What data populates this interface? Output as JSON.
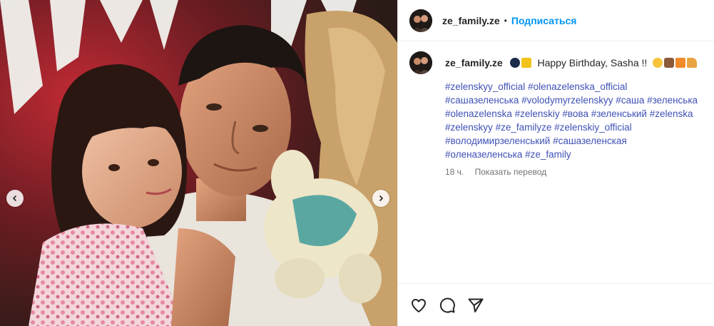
{
  "post": {
    "username": "ze_family.ze",
    "header_separator": "•",
    "follow_label": "Подписаться",
    "caption_text": "Happy Birthday, Sasha !!",
    "hashtags": [
      "#zelenskyy_official",
      "#olenazelenska_official",
      "#сашазеленська",
      "#volodymyrzelenskyy",
      "#саша",
      "#зеленська",
      "#olenazelenska",
      "#zelenskiy",
      "#вова",
      "#зеленський",
      "#zelenska",
      "#zelenskyy",
      "#ze_familyze",
      "#zelenskiy_official",
      "#володимирзеленський",
      "#сашазеленская",
      "#оленазеленська",
      "#ze_family"
    ],
    "time_ago": "18 ч.",
    "translate_label": "Показать перевод"
  },
  "icons": {
    "like": "heart-icon",
    "comment": "comment-icon",
    "share": "paper-plane-icon",
    "prev": "chevron-left-icon",
    "next": "chevron-right-icon"
  },
  "colors": {
    "follow": "#0095f6",
    "hashtag": "#3f51b5",
    "meta": "#737373",
    "text": "#262626"
  }
}
